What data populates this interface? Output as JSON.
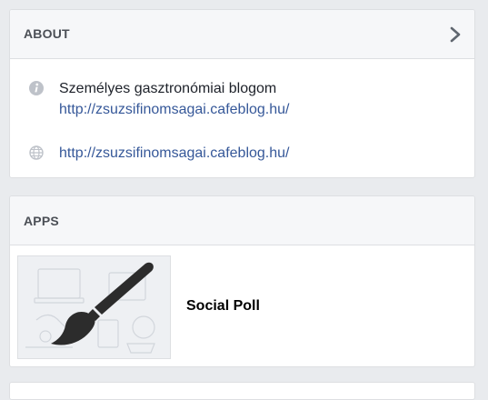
{
  "about": {
    "title": "ABOUT",
    "description": "Személyes gasztronómiai blogom",
    "description_link": "http://zsuzsifinomsagai.cafeblog.hu/",
    "website": "http://zsuzsifinomsagai.cafeblog.hu/",
    "icons": {
      "info": "info-icon",
      "website": "globe-icon",
      "expand": "chevron-right-icon"
    }
  },
  "apps": {
    "title": "APPS",
    "items": [
      {
        "name": "Social Poll",
        "icon": "paintbrush-icon"
      }
    ]
  },
  "colors": {
    "link": "#365899",
    "header_bg": "#f6f7f9",
    "page_bg": "#e9ebee"
  }
}
